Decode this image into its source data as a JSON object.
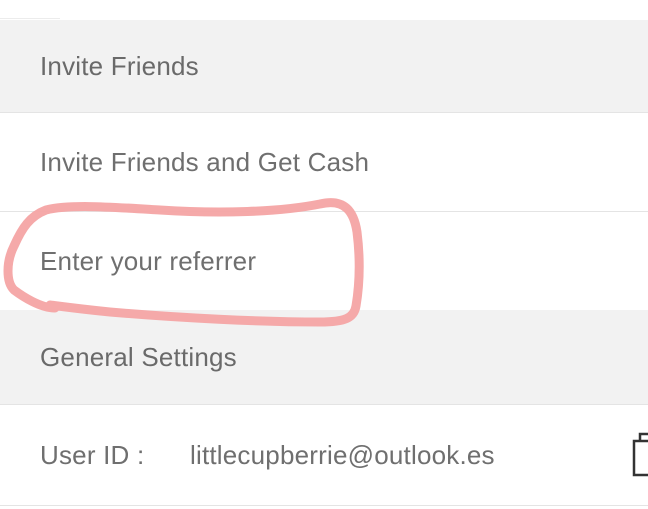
{
  "settings": {
    "section_invite": "Invite Friends",
    "invite_cash": "Invite Friends and Get Cash",
    "enter_referrer": "Enter your referrer",
    "section_general": "General Settings",
    "user_id_label": "User ID :",
    "user_id_value": "littlecupberrie@outlook.es"
  },
  "annotation": {
    "color": "#f4a4a4",
    "shape": "freehand-circle-around-enter-referrer"
  },
  "icons": {
    "copy": "copy-icon"
  }
}
